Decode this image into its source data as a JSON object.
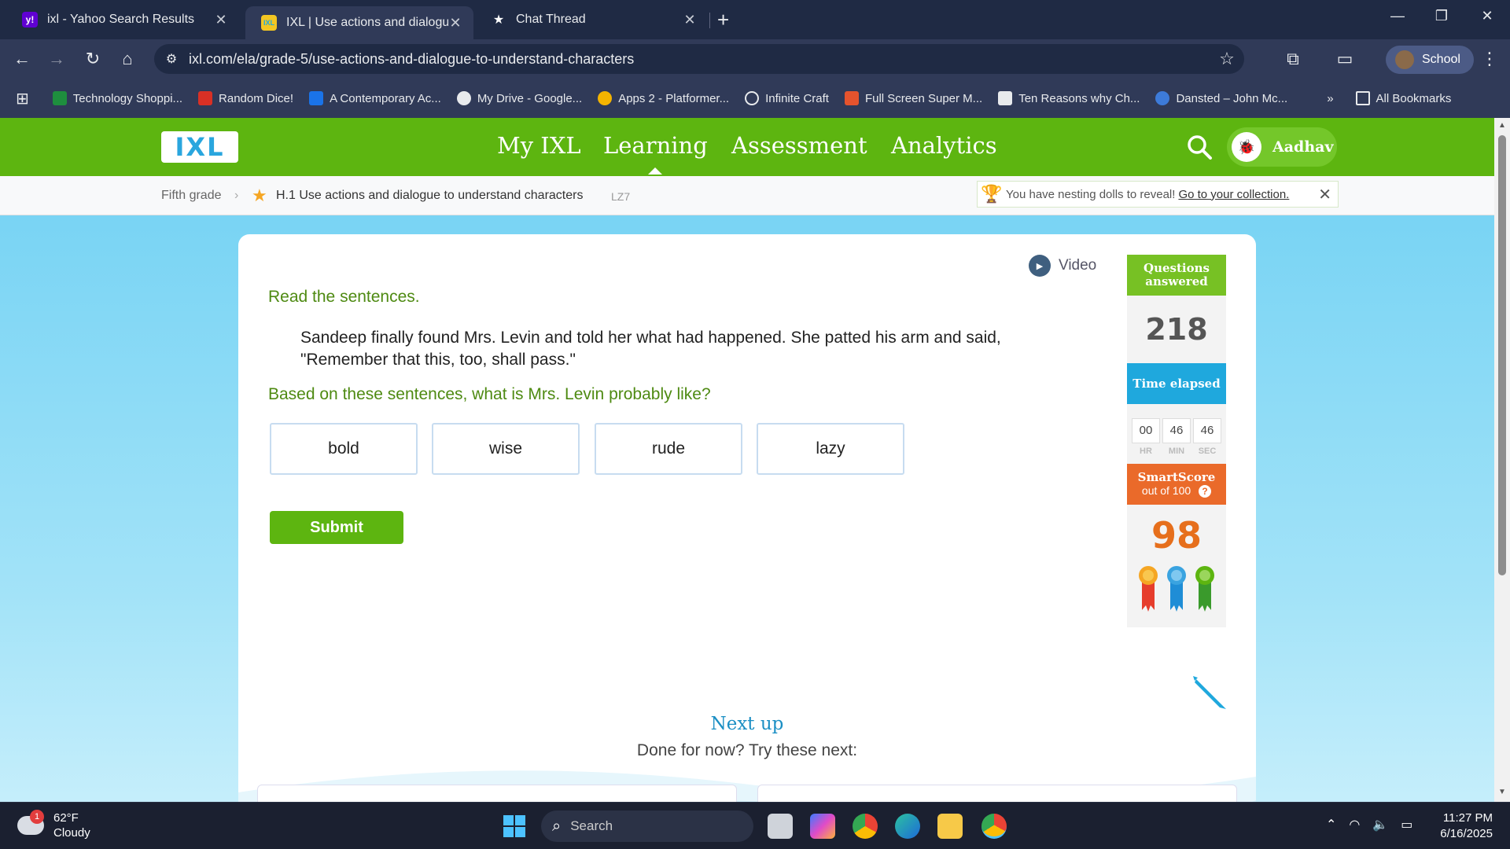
{
  "browser": {
    "tabs": [
      {
        "title": "ixl - Yahoo Search Results",
        "icon": "yahoo-icon"
      },
      {
        "title": "IXL | Use actions and dialogue t",
        "icon": "ixl-icon"
      },
      {
        "title": "Chat Thread",
        "icon": "star-icon"
      }
    ],
    "url": "ixl.com/ela/grade-5/use-actions-and-dialogue-to-understand-characters",
    "profile": "School",
    "bookmarks": [
      "Technology Shoppi...",
      "Random Dice!",
      "A Contemporary Ac...",
      "My Drive - Google...",
      "Apps 2 - Platformer...",
      "Infinite Craft",
      "Full Screen Super M...",
      "Ten Reasons why Ch...",
      "Dansted – John Mc..."
    ],
    "all_bookmarks": "All Bookmarks",
    "more": "»"
  },
  "ixl": {
    "logo": "IXL",
    "nav": [
      "My IXL",
      "Learning",
      "Assessment",
      "Analytics"
    ],
    "active_nav": "Learning",
    "user": "Aadhav",
    "breadcrumb": {
      "grade": "Fifth grade",
      "skill": "H.1 Use actions and dialogue to understand characters",
      "code": "LZ7"
    },
    "notice": {
      "text": "You have nesting dolls to reveal!",
      "link": "Go to your collection."
    },
    "question": {
      "video": "Video",
      "instruction": "Read the sentences.",
      "passage": "Sandeep finally found Mrs. Levin and told her what had happened. She patted his arm and said, \"Remember that this, too, shall pass.\"",
      "prompt": "Based on these sentences, what is Mrs. Levin probably like?",
      "choices": [
        "bold",
        "wise",
        "rude",
        "lazy"
      ],
      "submit": "Submit"
    },
    "stats": {
      "questions_label": "Questions answered",
      "questions_answered": "218",
      "time_label": "Time elapsed",
      "time": {
        "hr": "00",
        "min": "46",
        "sec": "46"
      },
      "time_units": {
        "hr": "HR",
        "min": "MIN",
        "sec": "SEC"
      },
      "smartscore_label": "SmartScore",
      "smartscore_sub": "out of 100",
      "smartscore": "98"
    },
    "next_up": "Next up",
    "done_for_now": "Done for now? Try these next:"
  },
  "taskbar": {
    "temp": "62°F",
    "condition": "Cloudy",
    "weather_badge": "1",
    "search": "Search",
    "time": "11:27 PM",
    "date": "6/16/2025"
  },
  "colors": {
    "ixl_green": "#5db510",
    "ixl_blue": "#1fa8dd",
    "smartscore_orange": "#e66f1c"
  }
}
